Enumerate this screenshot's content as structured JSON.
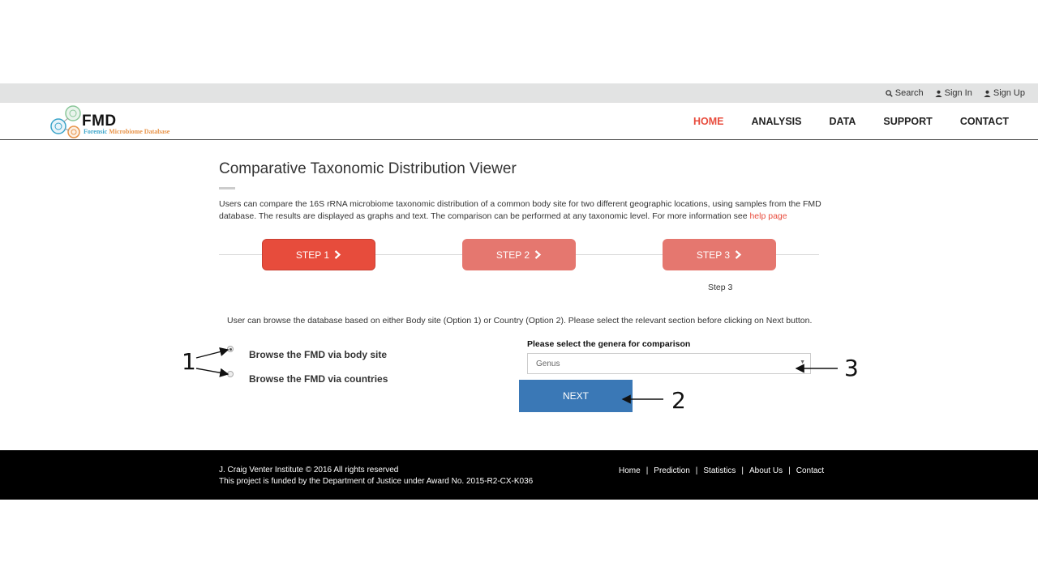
{
  "topbar": {
    "search_label": "Search",
    "signin_label": "Sign In",
    "signup_label": "Sign Up"
  },
  "logo": {
    "name": "FMD",
    "subtitle_part1": "Forensic",
    "subtitle_part2": "Microbiome Database"
  },
  "nav": {
    "items": [
      "HOME",
      "ANALYSIS",
      "DATA",
      "SUPPORT",
      "CONTACT"
    ],
    "active": "HOME"
  },
  "main": {
    "title": "Comparative Taxonomic Distribution Viewer",
    "intro_text": "Users can compare the 16S rRNA microbiome taxonomic distribution of a common body site for two different geographic locations, using samples from the FMD database. The results are displayed as graphs and text. The comparison can be performed at any taxonomic level. For more information see ",
    "help_link": "help page",
    "steps": [
      "STEP 1",
      "STEP 2",
      "STEP 3"
    ],
    "step_caption": "Step 3",
    "instructions": "User can browse the database based on either Body site (Option 1) or Country (Option 2). Please select the relevant section before clicking on Next button.",
    "options": [
      "Browse the FMD via body site",
      "Browse the FMD via countries"
    ],
    "selected_option": "Browse the FMD via body site",
    "select_label": "Please select the genera for comparison",
    "select_value": "Genus",
    "next_label": "NEXT"
  },
  "annotations": [
    "1",
    "2",
    "3"
  ],
  "footer": {
    "copyright": "J. Craig Venter Institute © 2016 All rights reserved",
    "funding": "This project is funded by the Department of Justice under Award No. 2015-R2-CX-K036",
    "links": [
      "Home",
      "Prediction",
      "Statistics",
      "About Us",
      "Contact"
    ],
    "separator": "|"
  },
  "colors": {
    "accent_red": "#e74c3c",
    "step_inactive": "#e5776f",
    "next_blue": "#3a78b6",
    "topbar_gray": "#e2e3e3",
    "footer_bg": "#000000"
  }
}
